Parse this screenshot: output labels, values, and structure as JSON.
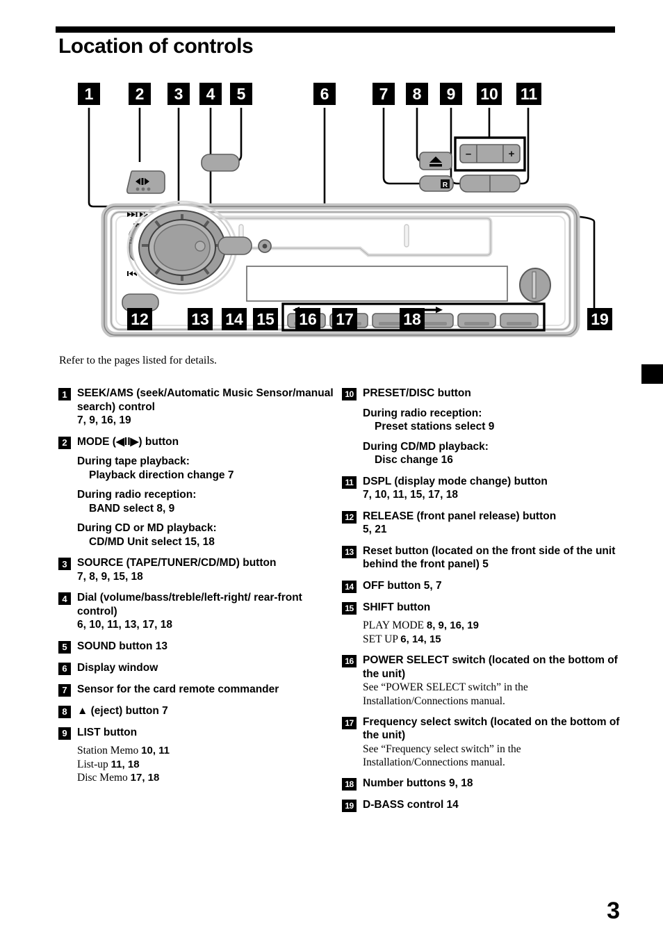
{
  "header": {
    "title": "Location of controls"
  },
  "intro": "Refer to the pages listed for details.",
  "page_number": "3",
  "diagram": {
    "callouts_top": [
      "1",
      "2",
      "3",
      "4",
      "5",
      "6",
      "7",
      "8",
      "9",
      "10",
      "11"
    ],
    "callouts_bottom": [
      "12",
      "13",
      "14",
      "15",
      "16",
      "17",
      "18",
      "19"
    ],
    "device_labels": {
      "mode_icon": "mode-arrows-icon",
      "seek_plus": "+",
      "seek_minus": "–",
      "seek_ff": "▶▶| ▶▶",
      "seek_rew": "|◀◀ ◀◀",
      "eject_icon": "▲",
      "remote_sensor_icon": "R",
      "preset_minus": "–",
      "preset_plus": "+",
      "number_row_left_arrow": "←",
      "number_row_right_arrow": "→"
    }
  },
  "controls_left": [
    {
      "num": "1",
      "title": "SEEK/AMS (seek/Automatic Music Sensor/manual search) control",
      "pages": "7, 9, 16, 19",
      "details": []
    },
    {
      "num": "2",
      "title": "MODE (◀II▶) button",
      "pages": "",
      "details": [
        {
          "head": "During tape playback:",
          "line": "Playback direction change  7"
        },
        {
          "head": "During radio reception:",
          "line": "BAND select  8, 9"
        },
        {
          "head": "During CD or MD playback:",
          "line": "CD/MD Unit select  15, 18"
        }
      ]
    },
    {
      "num": "3",
      "title": "SOURCE (TAPE/TUNER/CD/MD) button",
      "pages": "7, 8, 9, 15, 18",
      "details": []
    },
    {
      "num": "4",
      "title": "Dial (volume/bass/treble/left-right/ rear-front control)",
      "pages": "6, 10, 11, 13, 17, 18",
      "details": []
    },
    {
      "num": "5",
      "title": "SOUND button  13",
      "pages": "",
      "details": []
    },
    {
      "num": "6",
      "title": "Display window",
      "pages": "",
      "details": []
    },
    {
      "num": "7",
      "title": "Sensor for the card remote commander",
      "pages": "",
      "details": []
    },
    {
      "num": "8",
      "title": "▲ (eject) button  7",
      "pages": "",
      "details": []
    },
    {
      "num": "9",
      "title": "LIST button",
      "pages": "",
      "serif_lines": [
        {
          "text": "Station Memo ",
          "pages": "10, 11"
        },
        {
          "text": "List-up ",
          "pages": "11, 18"
        },
        {
          "text": "Disc Memo ",
          "pages": "17, 18"
        }
      ],
      "details": []
    }
  ],
  "controls_right": [
    {
      "num": "10",
      "title": "PRESET/DISC button",
      "pages": "",
      "details": [
        {
          "head": "During radio reception:",
          "line": "Preset stations select  9"
        },
        {
          "head": "During CD/MD playback:",
          "line": "Disc change 16"
        }
      ]
    },
    {
      "num": "11",
      "title": "DSPL (display mode change) button",
      "pages": "7, 10, 11, 15, 17, 18",
      "details": []
    },
    {
      "num": "12",
      "title": "RELEASE (front panel release) button",
      "pages": "5, 21",
      "details": []
    },
    {
      "num": "13",
      "title": "Reset button (located on the front side of the unit behind the front panel)  5",
      "pages": "",
      "details": []
    },
    {
      "num": "14",
      "title": "OFF button  5, 7",
      "pages": "",
      "details": []
    },
    {
      "num": "15",
      "title": "SHIFT button",
      "pages": "",
      "serif_lines": [
        {
          "text": "PLAY MODE ",
          "pages": "8, 9, 16, 19"
        },
        {
          "text": "SET UP ",
          "pages": "6, 14, 15"
        }
      ],
      "details": []
    },
    {
      "num": "16",
      "title": "POWER SELECT switch (located on the bottom of the unit)",
      "pages": "",
      "serif_note": "See “POWER SELECT switch” in the Installation/Connections manual.",
      "details": []
    },
    {
      "num": "17",
      "title": "Frequency select switch (located on the bottom of the unit)",
      "pages": "",
      "serif_note": "See “Frequency select switch” in the Installation/Connections manual.",
      "details": []
    },
    {
      "num": "18",
      "title": "Number buttons  9, 18",
      "pages": "",
      "details": []
    },
    {
      "num": "19",
      "title": "D-BASS control  14",
      "pages": "",
      "details": []
    }
  ],
  "colors": {
    "ink": "#000000",
    "panel_body": "#ffffff",
    "panel_shadow": "#bfbfbf",
    "button_gray": "#a8a8a8",
    "button_dark": "#8a8a8a",
    "dial_gray": "#999999"
  }
}
